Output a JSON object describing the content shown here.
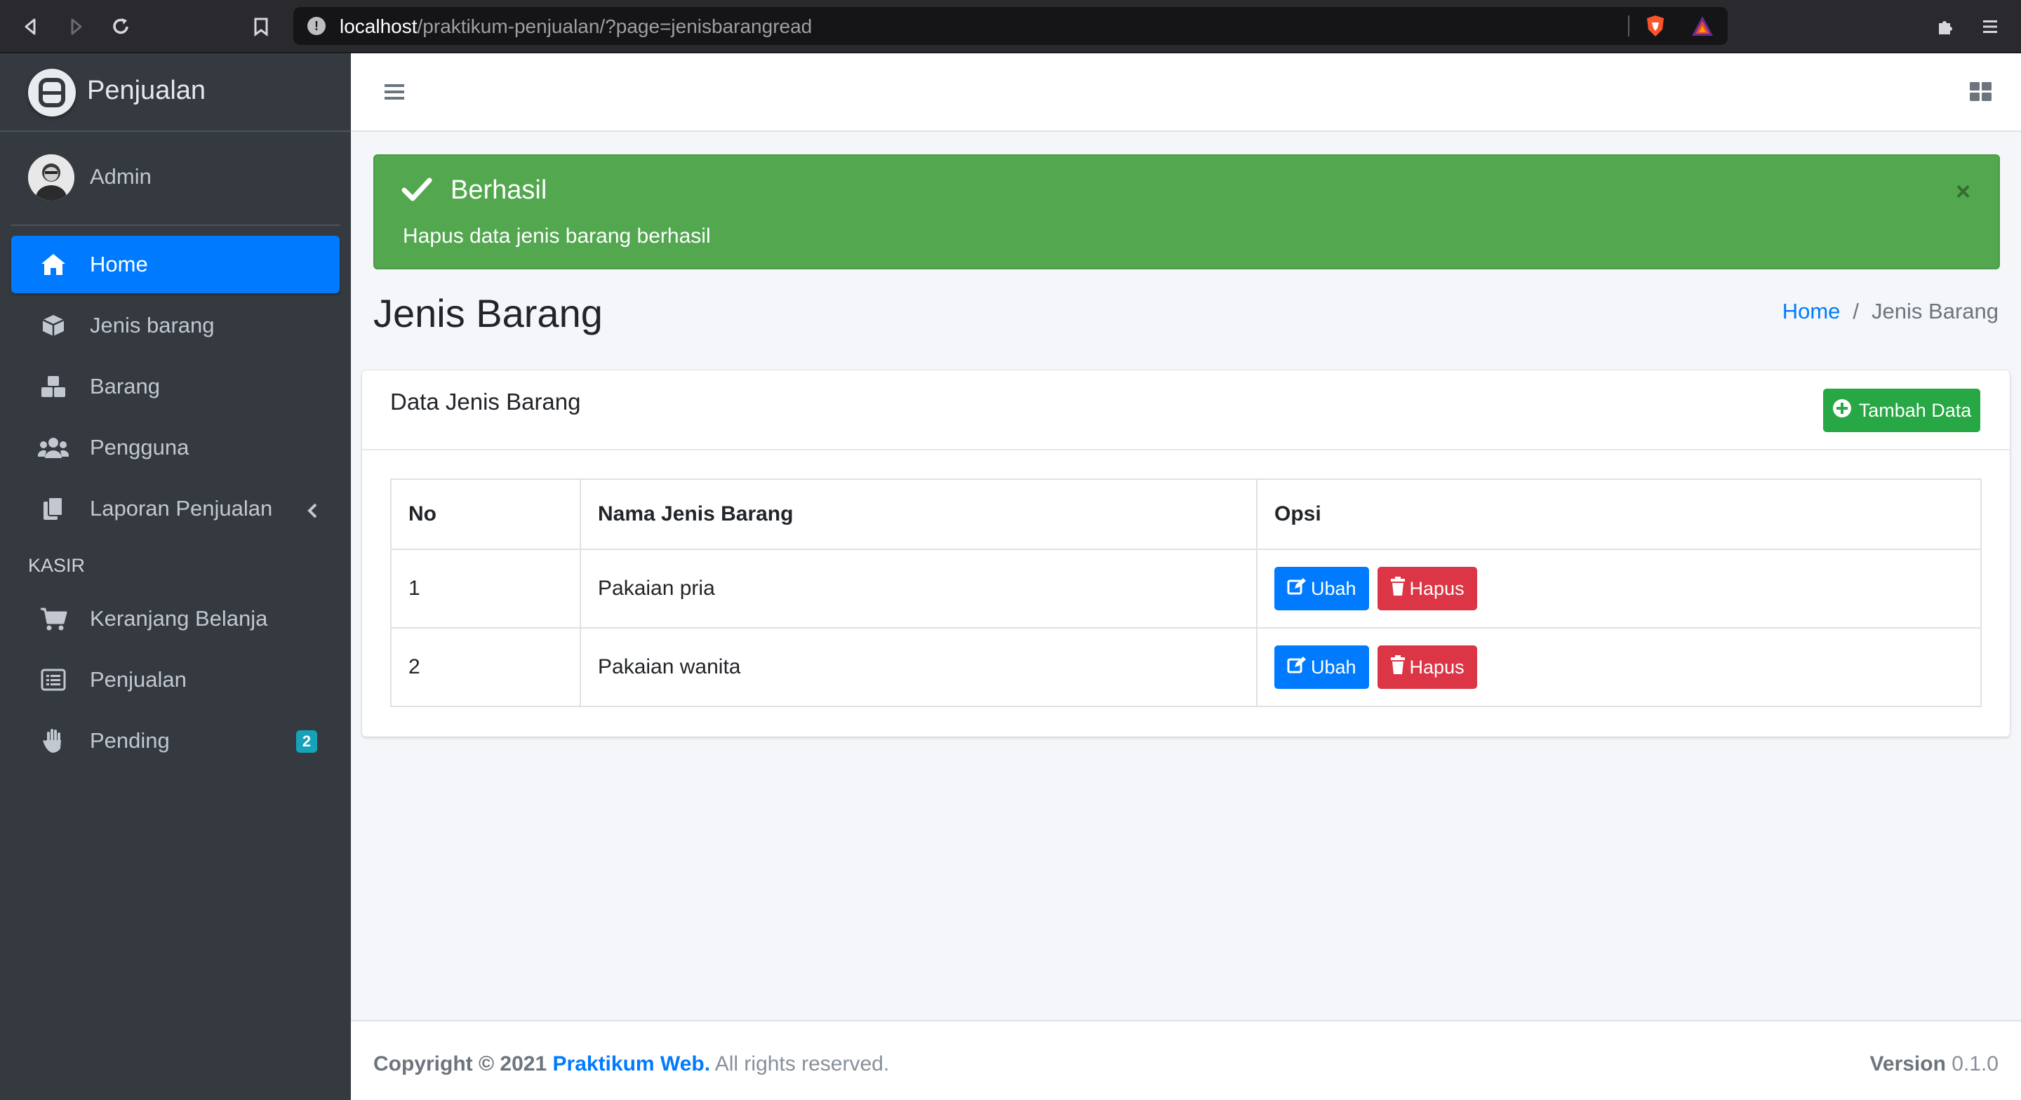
{
  "browser": {
    "url_host": "localhost",
    "url_path": "/praktikum-penjualan/?page=jenisbarangread"
  },
  "sidebar": {
    "brand": "Penjualan",
    "user_name": "Admin",
    "items": [
      {
        "label": "Home",
        "icon": "home-icon",
        "active": true
      },
      {
        "label": "Jenis barang",
        "icon": "box-icon"
      },
      {
        "label": "Barang",
        "icon": "boxes-icon"
      },
      {
        "label": "Pengguna",
        "icon": "users-icon"
      },
      {
        "label": "Laporan Penjualan",
        "icon": "copy-icon",
        "has_submenu": true
      }
    ],
    "section_header": "KASIR",
    "kasir_items": [
      {
        "label": "Keranjang Belanja",
        "icon": "cart-icon"
      },
      {
        "label": "Penjualan",
        "icon": "list-icon"
      },
      {
        "label": "Pending",
        "icon": "hand-icon",
        "badge": "2"
      }
    ]
  },
  "alert": {
    "title": "Berhasil",
    "message": "Hapus data jenis barang berhasil",
    "close": "×"
  },
  "page": {
    "title": "Jenis Barang",
    "breadcrumb_home": "Home",
    "breadcrumb_sep": "/",
    "breadcrumb_current": "Jenis Barang"
  },
  "card": {
    "title": "Data Jenis Barang",
    "add_button": "Tambah Data"
  },
  "table": {
    "headers": [
      "No",
      "Nama Jenis Barang",
      "Opsi"
    ],
    "rows": [
      {
        "no": "1",
        "name": "Pakaian pria"
      },
      {
        "no": "2",
        "name": "Pakaian wanita"
      }
    ],
    "edit_label": "Ubah",
    "delete_label": "Hapus"
  },
  "footer": {
    "copyright_prefix": "Copyright © 2021",
    "site_name": "Praktikum Web.",
    "rights": "All rights reserved.",
    "version_label": "Version",
    "version_number": "0.1.0"
  },
  "colors": {
    "sidebar_bg": "#343a40",
    "primary": "#007bff",
    "success": "#28a745",
    "danger": "#dc3545",
    "alert_bg": "#52a74f",
    "badge": "#17a2b8"
  }
}
